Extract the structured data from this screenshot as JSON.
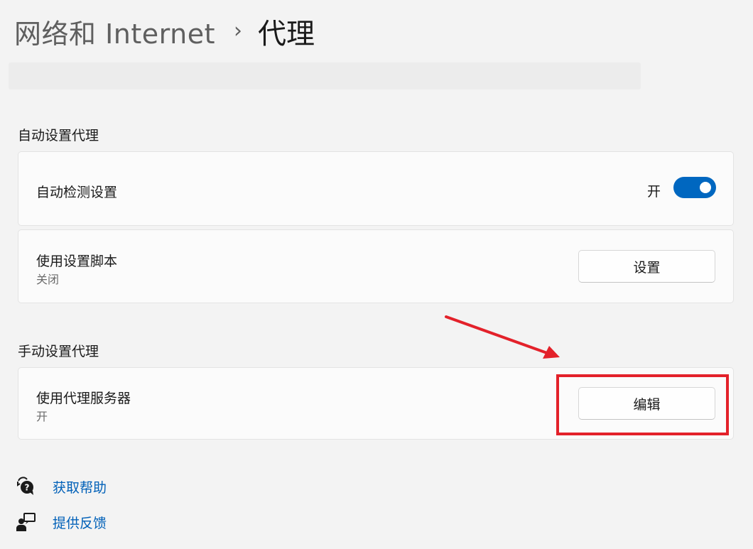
{
  "breadcrumb": {
    "parent": "网络和 Internet",
    "separator": "›",
    "current": "代理"
  },
  "auto_proxy": {
    "section_title": "自动设置代理",
    "detect": {
      "label": "自动检测设置",
      "state_text": "开",
      "enabled": true
    },
    "script": {
      "label": "使用设置脚本",
      "status": "关闭",
      "button_label": "设置"
    }
  },
  "manual_proxy": {
    "section_title": "手动设置代理",
    "server": {
      "label": "使用代理服务器",
      "status": "开",
      "button_label": "编辑"
    }
  },
  "links": {
    "help": "获取帮助",
    "feedback": "提供反馈"
  },
  "icons": {
    "help": "help-chat-icon",
    "feedback": "feedback-icon",
    "separator": "chevron-right-icon"
  },
  "colors": {
    "accent": "#0067c0",
    "link": "#0060b8",
    "annotation": "#e3212a"
  }
}
